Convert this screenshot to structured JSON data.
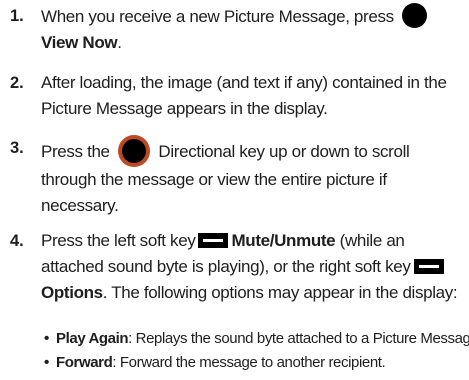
{
  "steps": [
    {
      "number": "1.",
      "text_before_key": "When you receive a new Picture Message, press",
      "bold_after": "View Now",
      "text_after": "."
    },
    {
      "number": "2.",
      "text": "After loading, the image (and text if any) contained in the Picture Message appears in the display."
    },
    {
      "number": "3.",
      "text_before_key": "Press the",
      "text_after": "Directional key up or down to scroll through the message or view the entire picture if necessary."
    },
    {
      "number": "4.",
      "text_start": "Press the left soft key",
      "bold_1": "Mute/Unmute",
      "text_mid": "(while an attached sound byte is playing), or the right soft key",
      "bold_2": "Options",
      "text_end": ". The following options may appear in the display:",
      "bullets": [
        {
          "term": "Play Again",
          "desc": ": Replays the sound byte attached to a Picture Message."
        },
        {
          "term": "Forward",
          "desc": ": Forward the message to another recipient."
        }
      ]
    }
  ],
  "icons": {
    "ok_key": "ok-key-icon",
    "directional_key": "directional-key-icon",
    "soft_key": "soft-key-icon"
  },
  "colors": {
    "text": "#1e1e1e",
    "directional_key_ring": "#bd4a22"
  }
}
